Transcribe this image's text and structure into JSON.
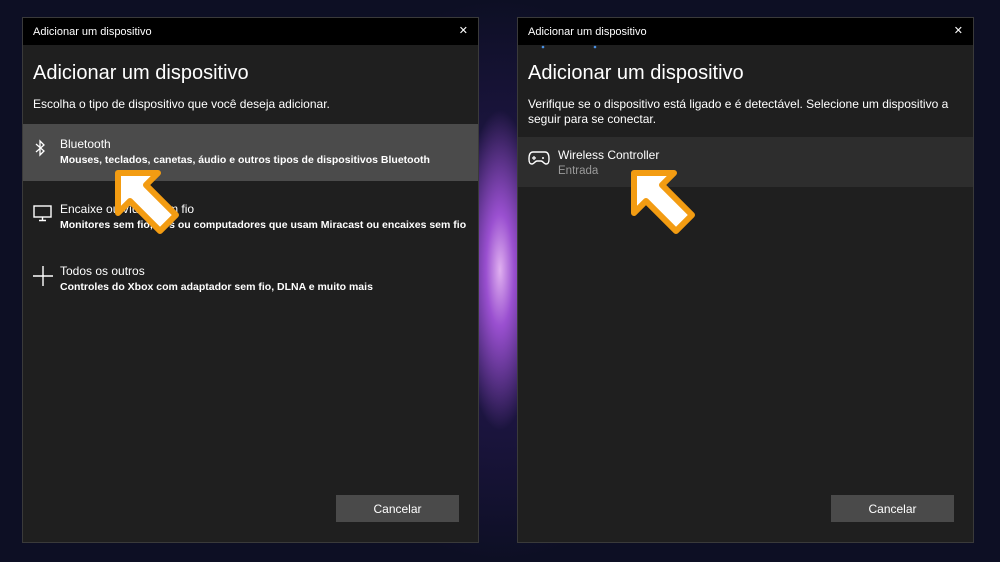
{
  "left_dialog": {
    "window_title": "Adicionar um dispositivo",
    "heading": "Adicionar um dispositivo",
    "description": "Escolha o tipo de dispositivo que você deseja adicionar.",
    "options": [
      {
        "icon": "bluetooth-icon",
        "title": "Bluetooth",
        "subtitle": "Mouses, teclados, canetas, áudio e outros tipos de dispositivos Bluetooth",
        "selected": true
      },
      {
        "icon": "monitor-icon",
        "title": "Encaixe ou vídeo sem fio",
        "subtitle": "Monitores sem fio, TVs ou computadores que usam Miracast ou encaixes sem fio",
        "selected": false
      },
      {
        "icon": "plus-icon",
        "title": "Todos os outros",
        "subtitle": "Controles do Xbox com adaptador sem fio, DLNA e muito mais",
        "selected": false
      }
    ],
    "cancel_label": "Cancelar"
  },
  "right_dialog": {
    "window_title": "Adicionar um dispositivo",
    "heading": "Adicionar um dispositivo",
    "description": "Verifique se o dispositivo está ligado e é detectável. Selecione um dispositivo a seguir para se conectar.",
    "devices": [
      {
        "icon": "gamepad-icon",
        "name": "Wireless Controller",
        "category": "Entrada"
      }
    ],
    "cancel_label": "Cancelar"
  },
  "colors": {
    "arrow_outline": "#f39c12",
    "arrow_fill": "#ffffff",
    "accent_dots": "#4a90e2"
  }
}
